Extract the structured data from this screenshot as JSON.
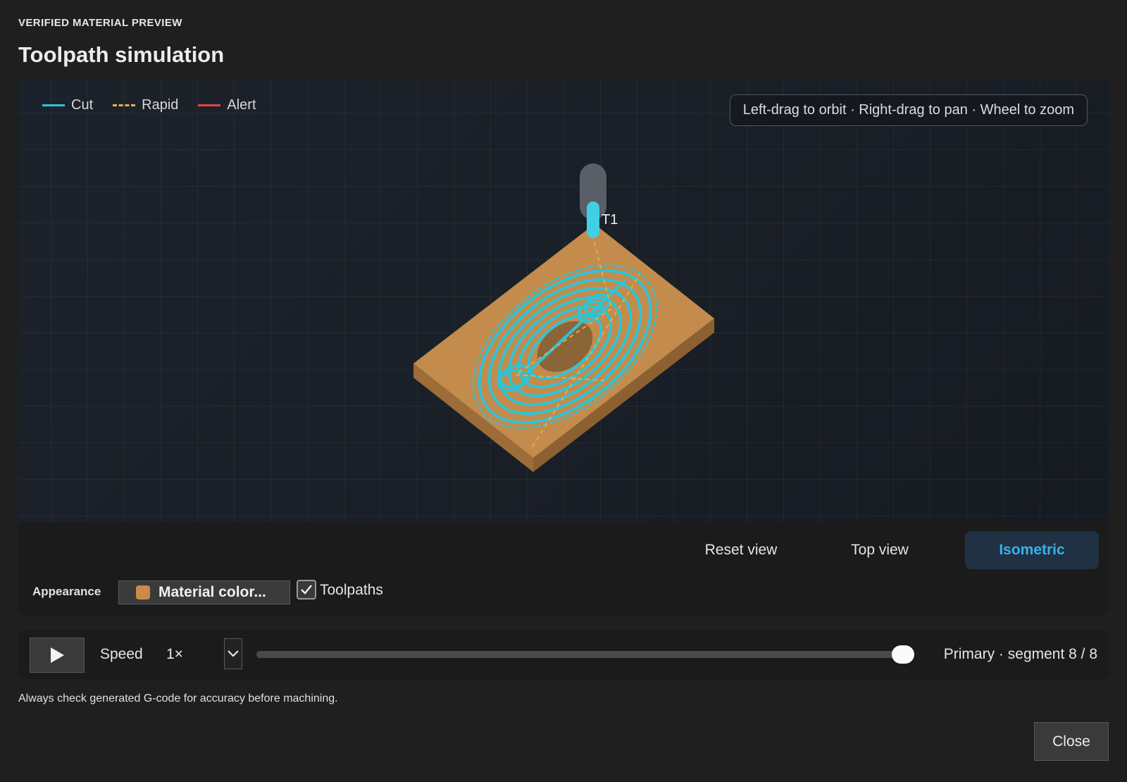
{
  "header": {
    "overline": "VERIFIED MATERIAL PREVIEW",
    "title": "Toolpath simulation"
  },
  "viewport": {
    "legend": [
      {
        "label": "Cut",
        "color": "#2ec4d6",
        "style": "solid"
      },
      {
        "label": "Rapid",
        "color": "#e8b04a",
        "style": "dashed"
      },
      {
        "label": "Alert",
        "color": "#e0453f",
        "style": "solid"
      }
    ],
    "hint": "Left-drag to orbit · Right-drag to pan · Wheel to zoom",
    "tool_label": "T1",
    "colors": {
      "material_top": "#c38b4c",
      "material_side": "#9d6d39",
      "cut": "#2ec4d6",
      "rapid": "#e8b04a",
      "tool_holder": "#5a5e66",
      "tool_tip": "#3fd0e4"
    }
  },
  "view_controls": {
    "reset": "Reset view",
    "top": "Top view",
    "isometric": "Isometric",
    "active": "isometric"
  },
  "appearance": {
    "label": "Appearance",
    "material_button": "Material color...",
    "material_color": "#c98a4a",
    "toolpaths_label": "Toolpaths",
    "toolpaths_checked": true
  },
  "playback": {
    "speed_label": "Speed",
    "speed_value": "1×",
    "progress": 1.0,
    "segment_text": "Primary · segment 8 / 8"
  },
  "footer": {
    "disclaimer": "Always check generated G-code for accuracy before machining.",
    "close": "Close"
  }
}
